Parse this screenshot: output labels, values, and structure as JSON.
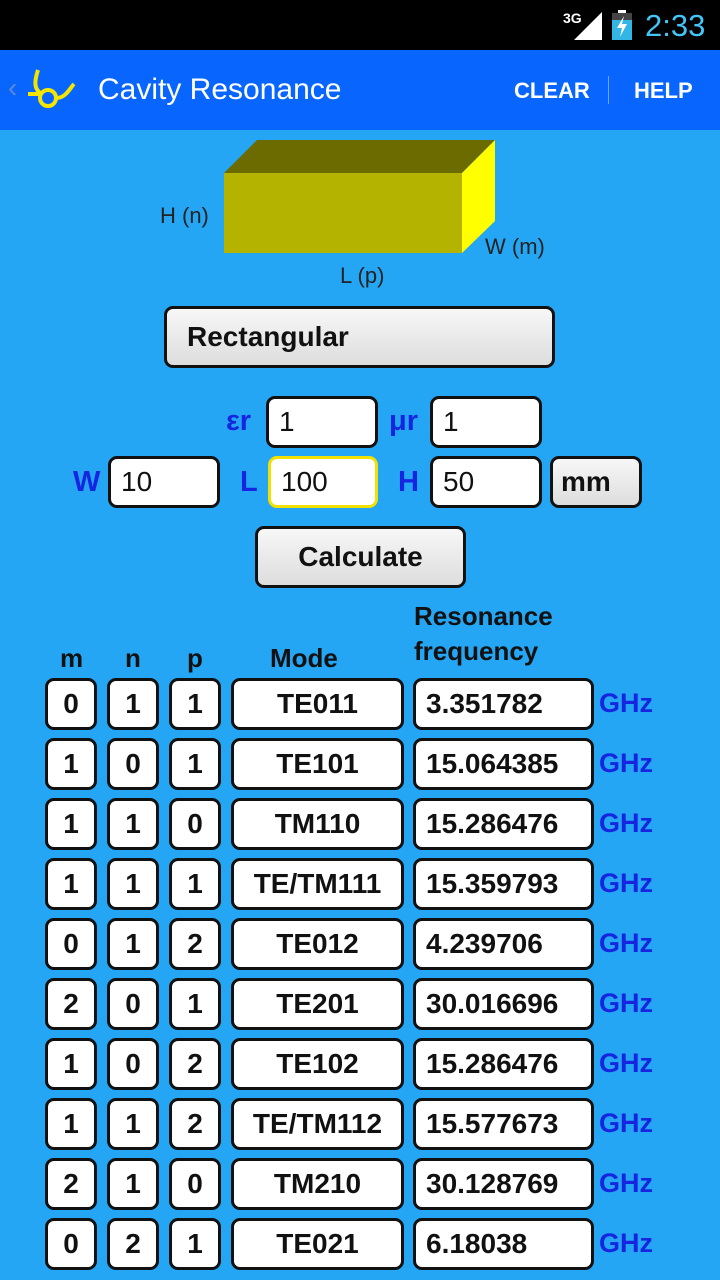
{
  "status": {
    "network": "3G",
    "time": "2:33"
  },
  "appbar": {
    "title": "Cavity Resonance",
    "clear_label": "CLEAR",
    "help_label": "HELP"
  },
  "diagram": {
    "h_label": "H (n)",
    "w_label": "W (m)",
    "l_label": "L (p)"
  },
  "shape_select": {
    "value": "Rectangular"
  },
  "inputs": {
    "er": {
      "label": "εr",
      "value": "1"
    },
    "ur": {
      "label": "μr",
      "value": "1"
    },
    "w": {
      "label": "W",
      "value": "10"
    },
    "l": {
      "label": "L",
      "value": "100"
    },
    "h": {
      "label": "H",
      "value": "50"
    },
    "unit": "mm"
  },
  "calculate_label": "Calculate",
  "table": {
    "headers": {
      "m": "m",
      "n": "n",
      "p": "p",
      "mode": "Mode",
      "freq1": "Resonance",
      "freq2": "frequency"
    },
    "rows": [
      {
        "m": "0",
        "n": "1",
        "p": "1",
        "mode": "TE011",
        "freq": "3.351782",
        "unit": "GHz"
      },
      {
        "m": "1",
        "n": "0",
        "p": "1",
        "mode": "TE101",
        "freq": "15.064385",
        "unit": "GHz"
      },
      {
        "m": "1",
        "n": "1",
        "p": "0",
        "mode": "TM110",
        "freq": "15.286476",
        "unit": "GHz"
      },
      {
        "m": "1",
        "n": "1",
        "p": "1",
        "mode": "TE/TM111",
        "freq": "15.359793",
        "unit": "GHz"
      },
      {
        "m": "0",
        "n": "1",
        "p": "2",
        "mode": "TE012",
        "freq": "4.239706",
        "unit": "GHz"
      },
      {
        "m": "2",
        "n": "0",
        "p": "1",
        "mode": "TE201",
        "freq": "30.016696",
        "unit": "GHz"
      },
      {
        "m": "1",
        "n": "0",
        "p": "2",
        "mode": "TE102",
        "freq": "15.286476",
        "unit": "GHz"
      },
      {
        "m": "1",
        "n": "1",
        "p": "2",
        "mode": "TE/TM112",
        "freq": "15.577673",
        "unit": "GHz"
      },
      {
        "m": "2",
        "n": "1",
        "p": "0",
        "mode": "TM210",
        "freq": "30.128769",
        "unit": "GHz"
      },
      {
        "m": "0",
        "n": "2",
        "p": "1",
        "mode": "TE021",
        "freq": "6.18038",
        "unit": "GHz"
      }
    ]
  },
  "colors": {
    "background": "#25a6f5",
    "appbar": "#0866ff",
    "label_blue": "#1626e0",
    "box_front": "#b3b300",
    "box_side": "#ffff00"
  }
}
